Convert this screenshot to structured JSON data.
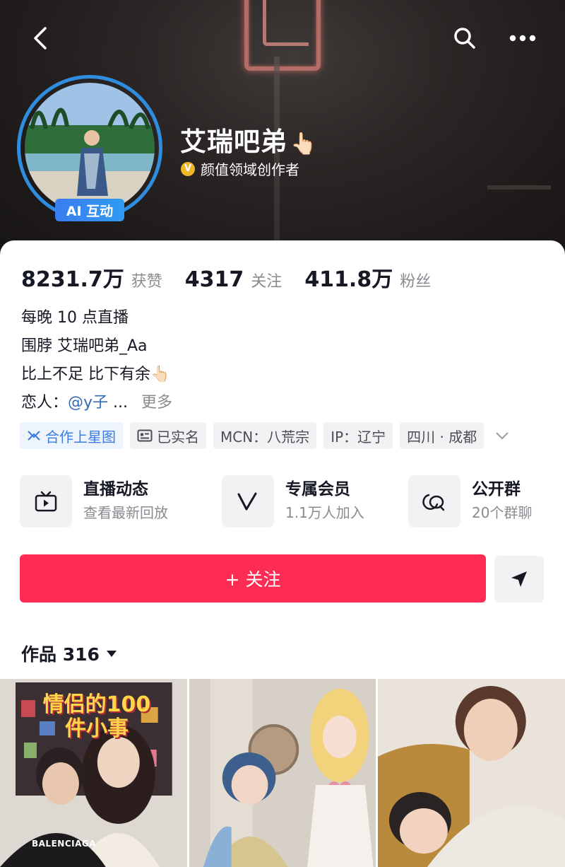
{
  "profile": {
    "name": "艾瑞吧弟",
    "name_emoji": "👆🏻",
    "verification_badge": "V",
    "verification_text": "颜值领域创作者",
    "ai_badge": "AI 互动"
  },
  "stats": [
    {
      "value": "8231.7万",
      "label": "获赞"
    },
    {
      "value": "4317",
      "label": "关注"
    },
    {
      "value": "411.8万",
      "label": "粉丝"
    }
  ],
  "bio": {
    "line1": "每晚 10 点直播",
    "line2": "围脖 艾瑞吧弟_Aa",
    "line3": "比上不足 比下有余",
    "line3_emoji": "👆🏻",
    "line4_prefix": "恋人：",
    "line4_mention": "@y子",
    "line4_ellipsis": "...",
    "more": "更多"
  },
  "tags": [
    {
      "label": "合作上星图",
      "icon": "star-map-icon"
    },
    {
      "label": "已实名",
      "icon": "id-card-icon"
    },
    {
      "label": "MCN：八荒宗"
    },
    {
      "label": "IP：辽宁"
    },
    {
      "label": "四川 · 成都"
    }
  ],
  "features": [
    {
      "title": "直播动态",
      "subtitle": "查看最新回放",
      "icon": "tv-icon"
    },
    {
      "title": "专属会员",
      "subtitle": "1.1万人加入",
      "icon": "member-v-icon"
    },
    {
      "title": "公开群",
      "subtitle": "20个群聊",
      "icon": "chat-bubbles-icon"
    }
  ],
  "actions": {
    "follow_label": "+ 关注"
  },
  "works": {
    "label": "作品 316"
  },
  "thumbnails": [
    {
      "caption": "情侣的100件小事",
      "logo_text": "BALENCIAGA"
    },
    {},
    {}
  ],
  "colors": {
    "follow_button": "#fe2c55",
    "ai_badge": "#3a7df0",
    "avatar_ring": "#2f8de0",
    "mention": "#3668b8",
    "verified": "#f1b629"
  }
}
